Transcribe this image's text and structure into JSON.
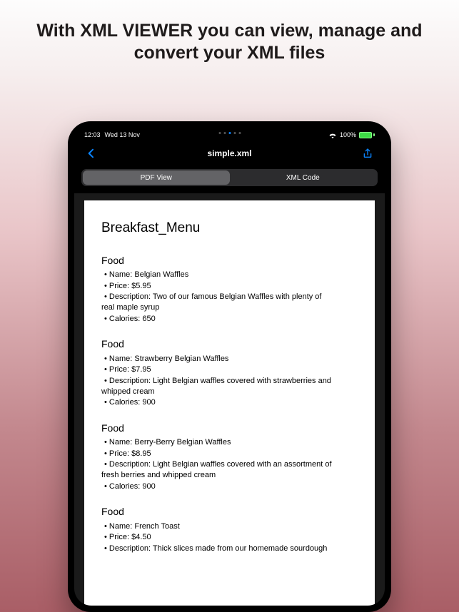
{
  "headline": "With XML VIEWER you can view, manage and convert your XML files",
  "status": {
    "time": "12:03",
    "date": "Wed 13 Nov",
    "battery_pct": "100%"
  },
  "nav": {
    "title": "simple.xml"
  },
  "segments": {
    "pdf": "PDF View",
    "xml": "XML Code"
  },
  "doc": {
    "title": "Breakfast_Menu",
    "foods": [
      {
        "heading": "Food",
        "name_line": "Name: Belgian Waffles",
        "price_line": "Price: $5.95",
        "desc_line": "Description: Two of our famous Belgian Waffles with plenty of",
        "desc_cont": "real maple syrup",
        "cal_line": "Calories: 650"
      },
      {
        "heading": "Food",
        "name_line": "Name: Strawberry Belgian Waffles",
        "price_line": "Price: $7.95",
        "desc_line": "Description: Light Belgian waffles covered with strawberries and",
        "desc_cont": "whipped cream",
        "cal_line": "Calories: 900"
      },
      {
        "heading": "Food",
        "name_line": "Name: Berry-Berry Belgian Waffles",
        "price_line": "Price: $8.95",
        "desc_line": "Description: Light Belgian waffles covered with an assortment of",
        "desc_cont": "fresh berries and whipped cream",
        "cal_line": "Calories: 900"
      },
      {
        "heading": "Food",
        "name_line": "Name: French Toast",
        "price_line": "Price: $4.50",
        "desc_line": "Description: Thick slices made from our homemade sourdough",
        "desc_cont": "",
        "cal_line": ""
      }
    ]
  }
}
